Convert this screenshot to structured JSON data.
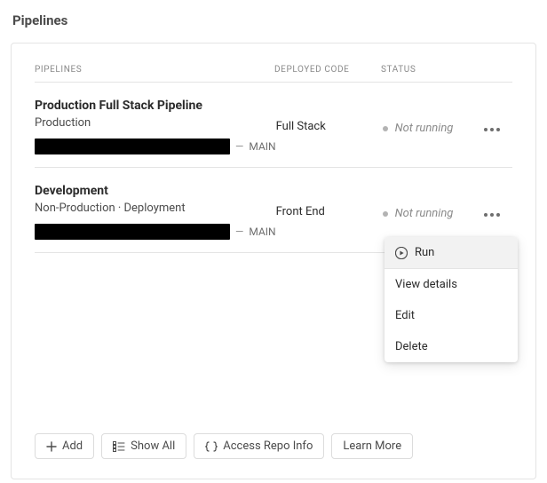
{
  "page_title": "Pipelines",
  "columns": {
    "pipelines": "PIPELINES",
    "deployed": "DEPLOYED CODE",
    "status": "STATUS"
  },
  "rows": [
    {
      "title": "Production Full Stack Pipeline",
      "subtitle": "Production",
      "branch": "MAIN",
      "deployed": "Full Stack",
      "status": "Not running"
    },
    {
      "title": "Development",
      "subtitle": "Non-Production  ·  Deployment",
      "branch": "MAIN",
      "deployed": "Front End",
      "status": "Not running"
    }
  ],
  "menu": {
    "run": "Run",
    "view": "View details",
    "edit": "Edit",
    "delete": "Delete"
  },
  "footer": {
    "add": "Add",
    "showall": "Show All",
    "repoinfo": "Access Repo Info",
    "learnmore": "Learn More"
  }
}
